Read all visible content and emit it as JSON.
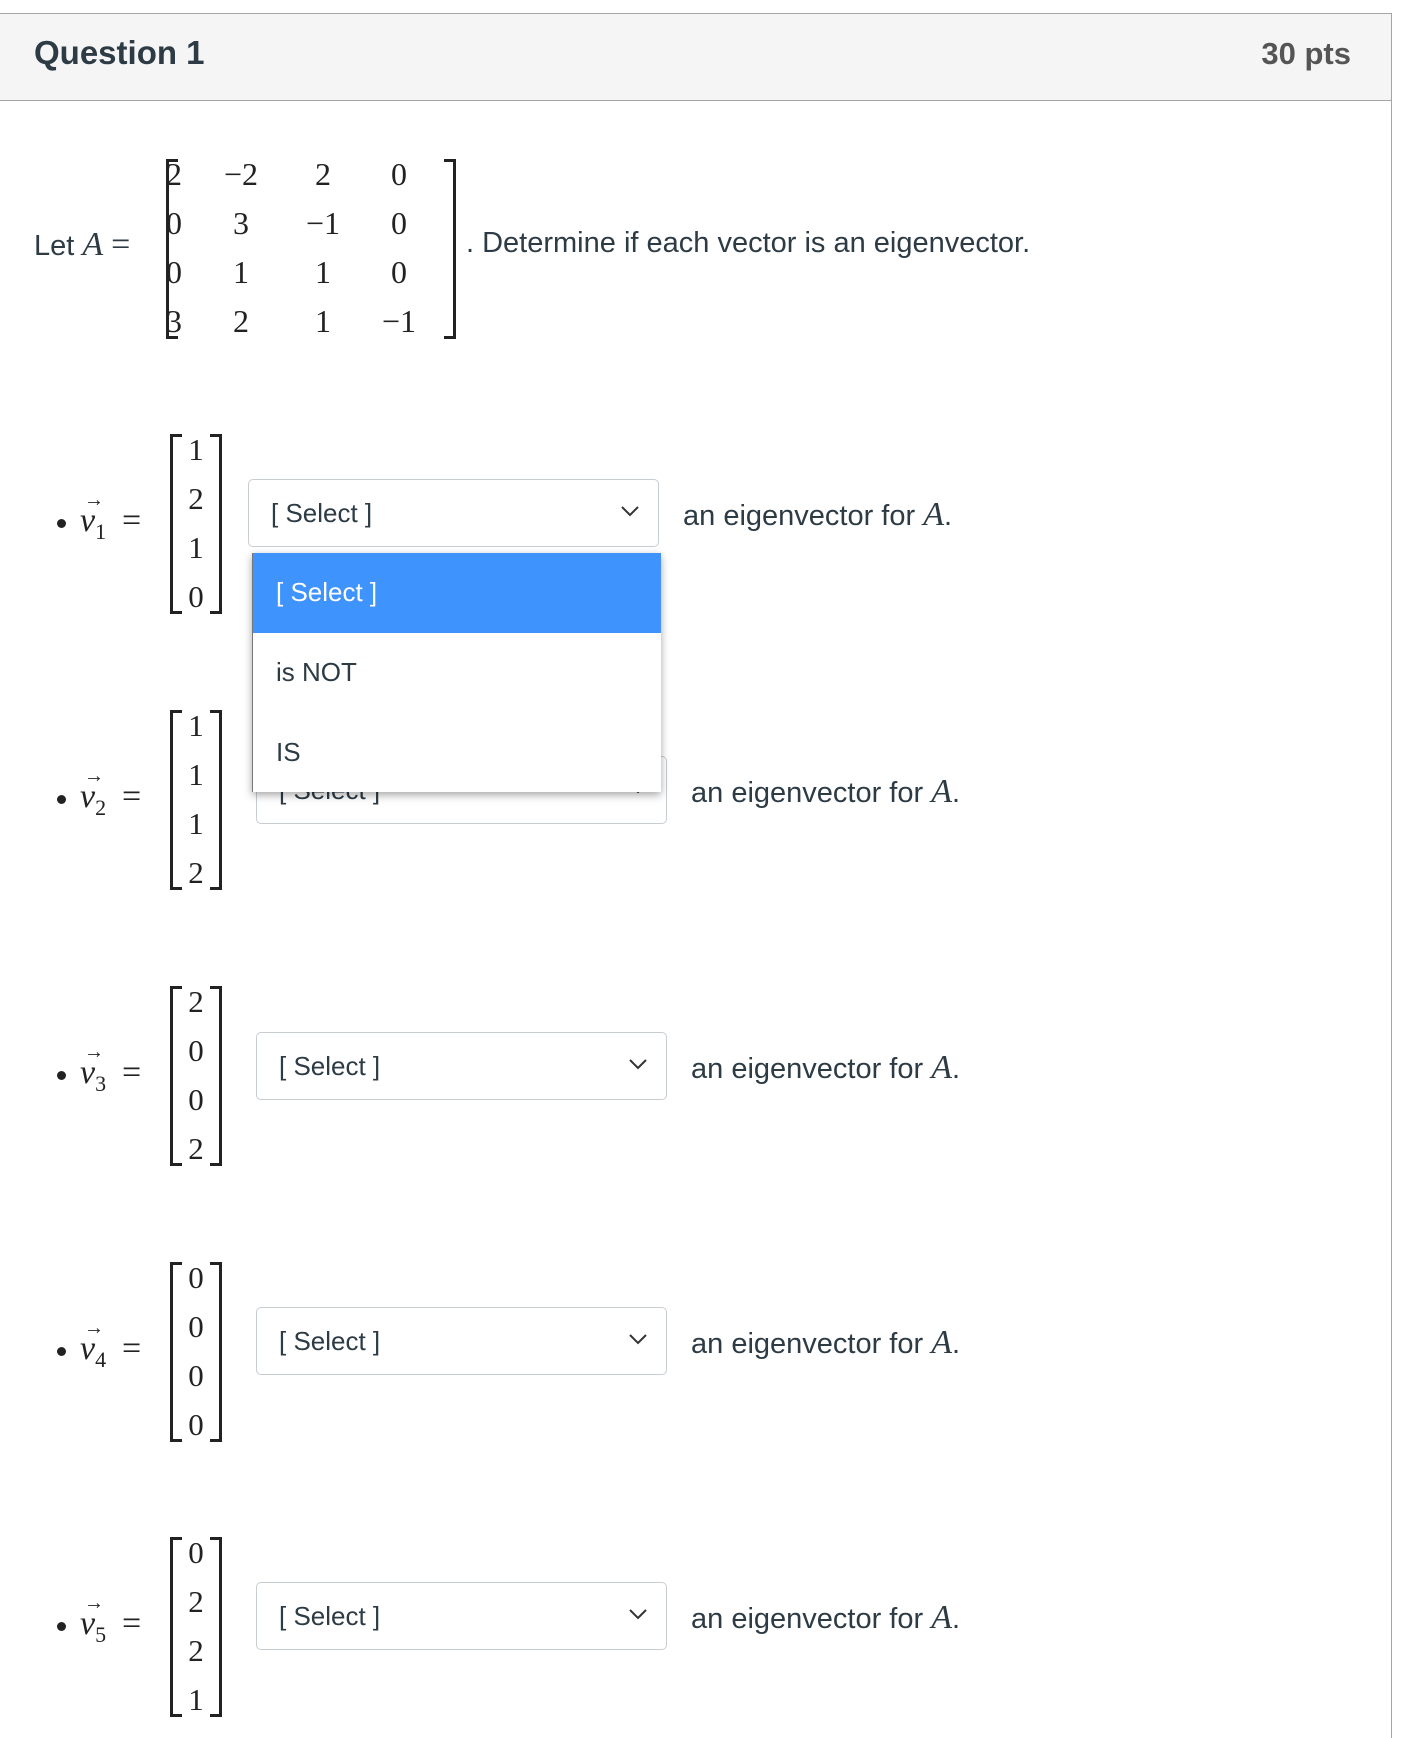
{
  "question": {
    "title": "Question 1",
    "points": "30 pts"
  },
  "prompt": {
    "let_text": "Let",
    "matrix_symbol": "A",
    "equals": "=",
    "matrix": [
      [
        "2",
        "−2",
        "2",
        "0"
      ],
      [
        "0",
        "3",
        "−1",
        "0"
      ],
      [
        "0",
        "1",
        "1",
        "0"
      ],
      [
        "3",
        "2",
        "1",
        "−1"
      ]
    ],
    "instruction": ". Determine if each vector is an eigenvector."
  },
  "vectors": [
    {
      "name": "v",
      "subscript": "1",
      "values": [
        "1",
        "2",
        "1",
        "0"
      ],
      "selected": "[ Select ]",
      "suffix": "an eigenvector for",
      "suffix_symbol": "A",
      "suffix_end": "."
    },
    {
      "name": "v",
      "subscript": "2",
      "values": [
        "1",
        "1",
        "1",
        "2"
      ],
      "selected": "[ Select ]",
      "suffix": "an eigenvector for",
      "suffix_symbol": "A",
      "suffix_end": "."
    },
    {
      "name": "v",
      "subscript": "3",
      "values": [
        "2",
        "0",
        "0",
        "2"
      ],
      "selected": "[ Select ]",
      "suffix": "an eigenvector for",
      "suffix_symbol": "A",
      "suffix_end": "."
    },
    {
      "name": "v",
      "subscript": "4",
      "values": [
        "0",
        "0",
        "0",
        "0"
      ],
      "selected": "[ Select ]",
      "suffix": "an eigenvector for",
      "suffix_symbol": "A",
      "suffix_end": "."
    },
    {
      "name": "v",
      "subscript": "5",
      "values": [
        "0",
        "2",
        "2",
        "1"
      ],
      "selected": "[ Select ]",
      "suffix": "an eigenvector for",
      "suffix_symbol": "A",
      "suffix_end": "."
    }
  ],
  "dropdown_open": {
    "for_vector": 1,
    "options": [
      "[ Select ]",
      "is NOT",
      "IS"
    ],
    "highlighted_index": 0,
    "highlight_color": "#3f93fc"
  },
  "icons": {
    "chevron": "chevron-down-icon",
    "arrow": "→"
  }
}
